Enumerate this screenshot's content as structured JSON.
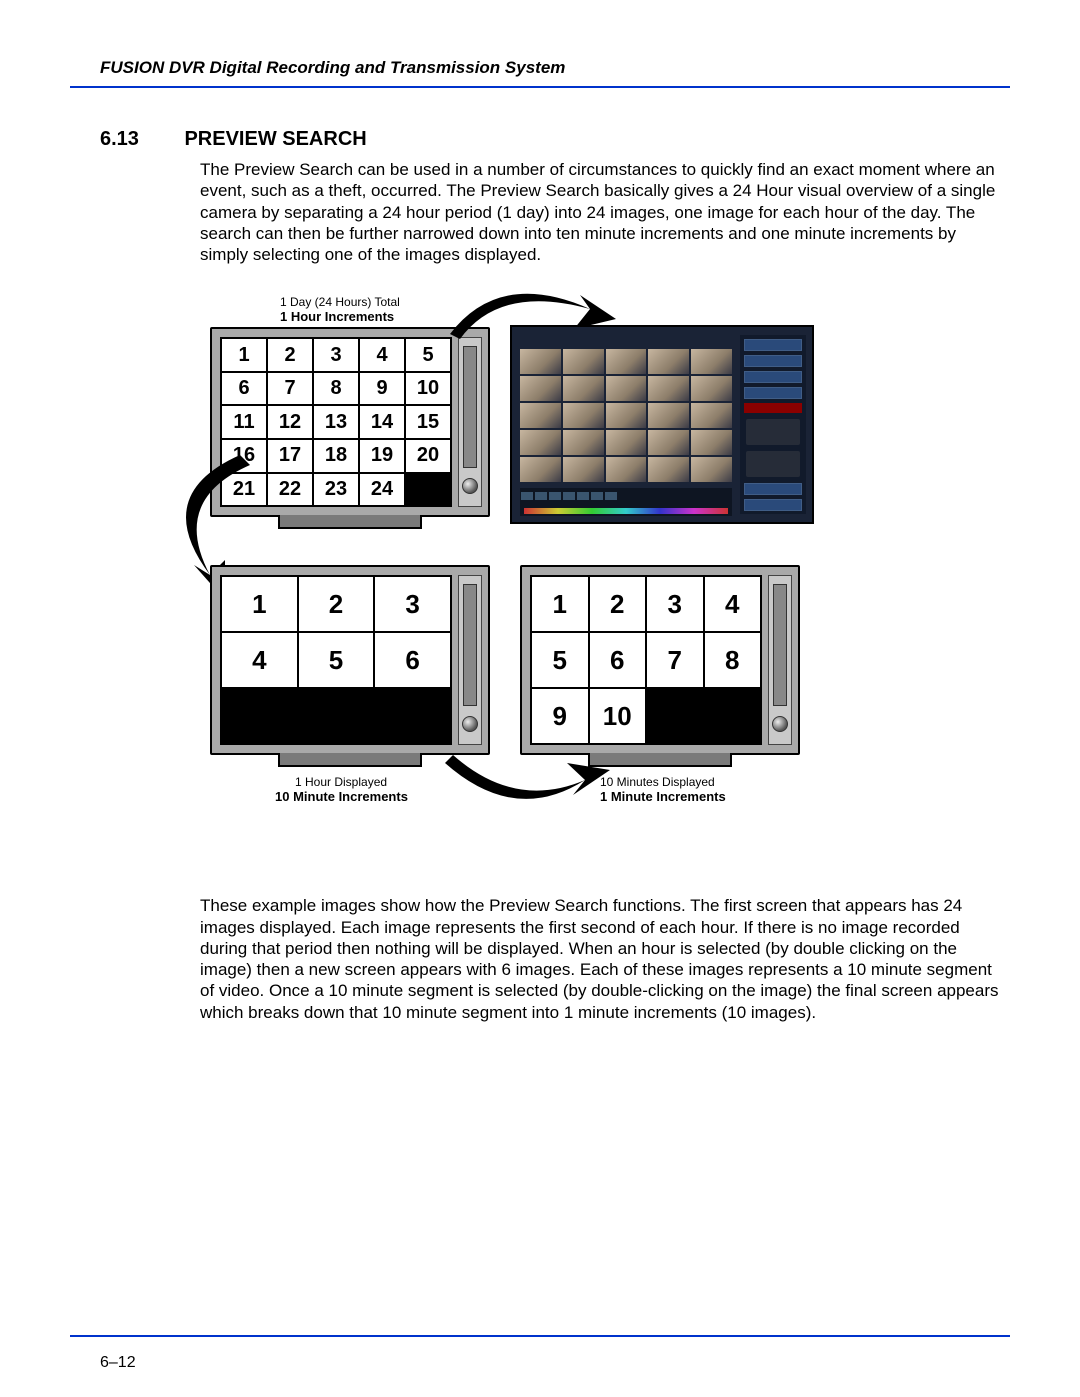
{
  "header": "FUSION DVR Digital Recording and Transmission System",
  "section": {
    "num": "6.13",
    "title": "PREVIEW SEARCH"
  },
  "para1": "The Preview Search can be used in a number of circumstances to quickly find an exact moment where an event, such as a theft, occurred. The Preview Search basically gives a 24 Hour visual overview of a single camera by separating a 24 hour period (1 day) into 24 images, one image for each hour of the day. The search can then be further narrowed down into ten minute increments and one minute increments by simply selecting one of the images displayed.",
  "para2": "These example images show how the Preview Search functions. The first screen that appears has 24 images displayed. Each image represents the first second of each hour. If there is no image recorded during that period then nothing will be displayed. When an hour is selected (by double clicking on the image) then a new screen appears with 6 images. Each of these images represents a 10 minute segment of video. Once a 10 minute segment is selected (by double-clicking on the image) the final screen appears which breaks down that 10 minute segment into 1 minute increments (10 images).",
  "captions": {
    "topSmall": "1 Day (24 Hours) Total",
    "topBold": "1 Hour Increments",
    "leftSmall": "1 Hour Displayed",
    "leftBold": "10 Minute Increments",
    "rightSmall": "10 Minutes Displayed",
    "rightBold": "1 Minute Increments"
  },
  "monitors": {
    "top": {
      "cols": 5,
      "rows": 5,
      "cells": [
        "1",
        "2",
        "3",
        "4",
        "5",
        "6",
        "7",
        "8",
        "9",
        "10",
        "11",
        "12",
        "13",
        "14",
        "15",
        "16",
        "17",
        "18",
        "19",
        "20",
        "21",
        "22",
        "23",
        "24",
        ""
      ]
    },
    "left": {
      "cols": 3,
      "rows": 3,
      "cells": [
        "1",
        "2",
        "3",
        "4",
        "5",
        "6",
        "",
        "",
        ""
      ]
    },
    "right": {
      "cols": 4,
      "rows": 3,
      "cells": [
        "1",
        "2",
        "3",
        "4",
        "5",
        "6",
        "7",
        "8",
        "9",
        "10",
        "",
        ""
      ]
    }
  },
  "pageNum": "6–12"
}
